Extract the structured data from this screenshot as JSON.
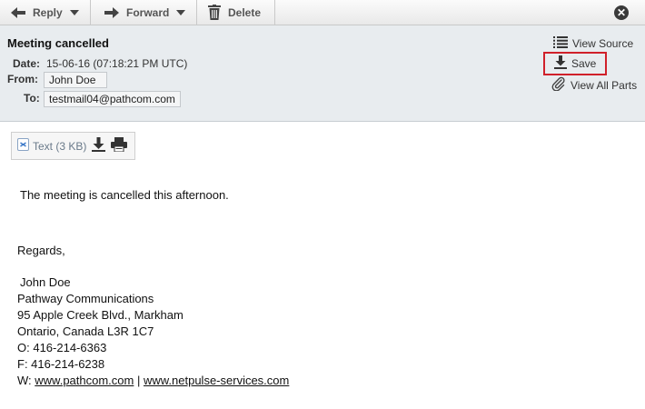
{
  "toolbar": {
    "reply_label": "Reply",
    "forward_label": "Forward",
    "delete_label": "Delete"
  },
  "message": {
    "subject": "Meeting cancelled",
    "date_label": "Date:",
    "date_value": "15-06-16 (07:18:21 PM UTC)",
    "from_label": "From:",
    "from_value": "John Doe",
    "to_label": "To:",
    "to_value": "testmail04@pathcom.com"
  },
  "actions": {
    "view_source": "View Source",
    "save": "Save",
    "view_all_parts": "View All Parts"
  },
  "attachment": {
    "name": "Text (3 KB)"
  },
  "body": {
    "line1": "The meeting is cancelled this afternoon.",
    "regards": "Regards,"
  },
  "signature": {
    "name": "John Doe",
    "company": "Pathway Communications",
    "address1": "95 Apple Creek Blvd., Markham",
    "address2": "Ontario, Canada L3R 1C7",
    "office": "O: 416-214-6363",
    "fax": "F: 416-214-6238",
    "web_prefix": "W: ",
    "web_link1": "www.pathcom.com",
    "web_separator": " | ",
    "web_link2": "www.netpulse-services.com"
  },
  "colors": {
    "highlight_border": "#d0202a",
    "header_bg": "#e8ecef"
  }
}
